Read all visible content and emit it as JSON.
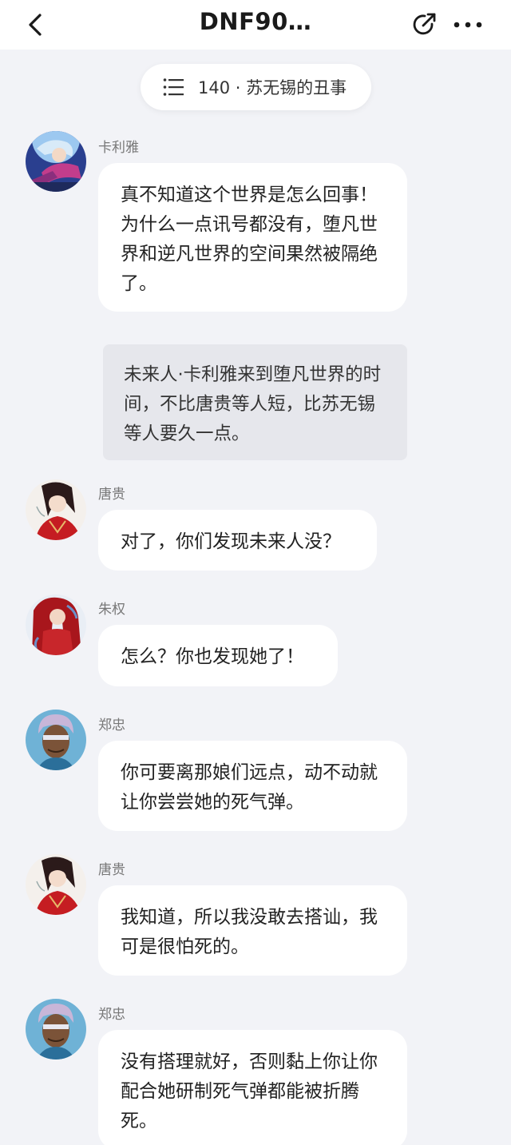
{
  "header": {
    "title": "DNF90…",
    "back_icon": "chevron-left-icon",
    "share_icon": "share-icon",
    "more_icon": "more-dots-icon"
  },
  "chapter": {
    "icon": "list-icon",
    "label": "140 · 苏无锡的丑事"
  },
  "messages": [
    {
      "speaker": "卡利雅",
      "text": "真不知道这个世界是怎么回事！为什么一点讯号都没有，堕凡世界和逆凡世界的空间果然被隔绝了。"
    },
    {
      "speaker": "唐贵",
      "text": "对了，你们发现未来人没？"
    },
    {
      "speaker": "朱权",
      "text": "怎么？你也发现她了！"
    },
    {
      "speaker": "郑忠",
      "text": "你可要离那娘们远点，动不动就让你尝尝她的死气弹。"
    },
    {
      "speaker": "唐贵",
      "text": "我知道，所以我没敢去搭讪，我可是很怕死的。"
    },
    {
      "speaker": "郑忠",
      "text": "没有搭理就好，否则黏上你让你配合她研制死气弹都能被折腾死。"
    }
  ],
  "narration": {
    "text": "未来人·卡利雅来到堕凡世界的时间，不比唐贵等人短，比苏无锡等人要久一点。"
  },
  "colors": {
    "background": "#f2f3f7",
    "bubble": "#ffffff",
    "narration_bg": "#e6e7ec",
    "speaker_text": "#777777"
  }
}
